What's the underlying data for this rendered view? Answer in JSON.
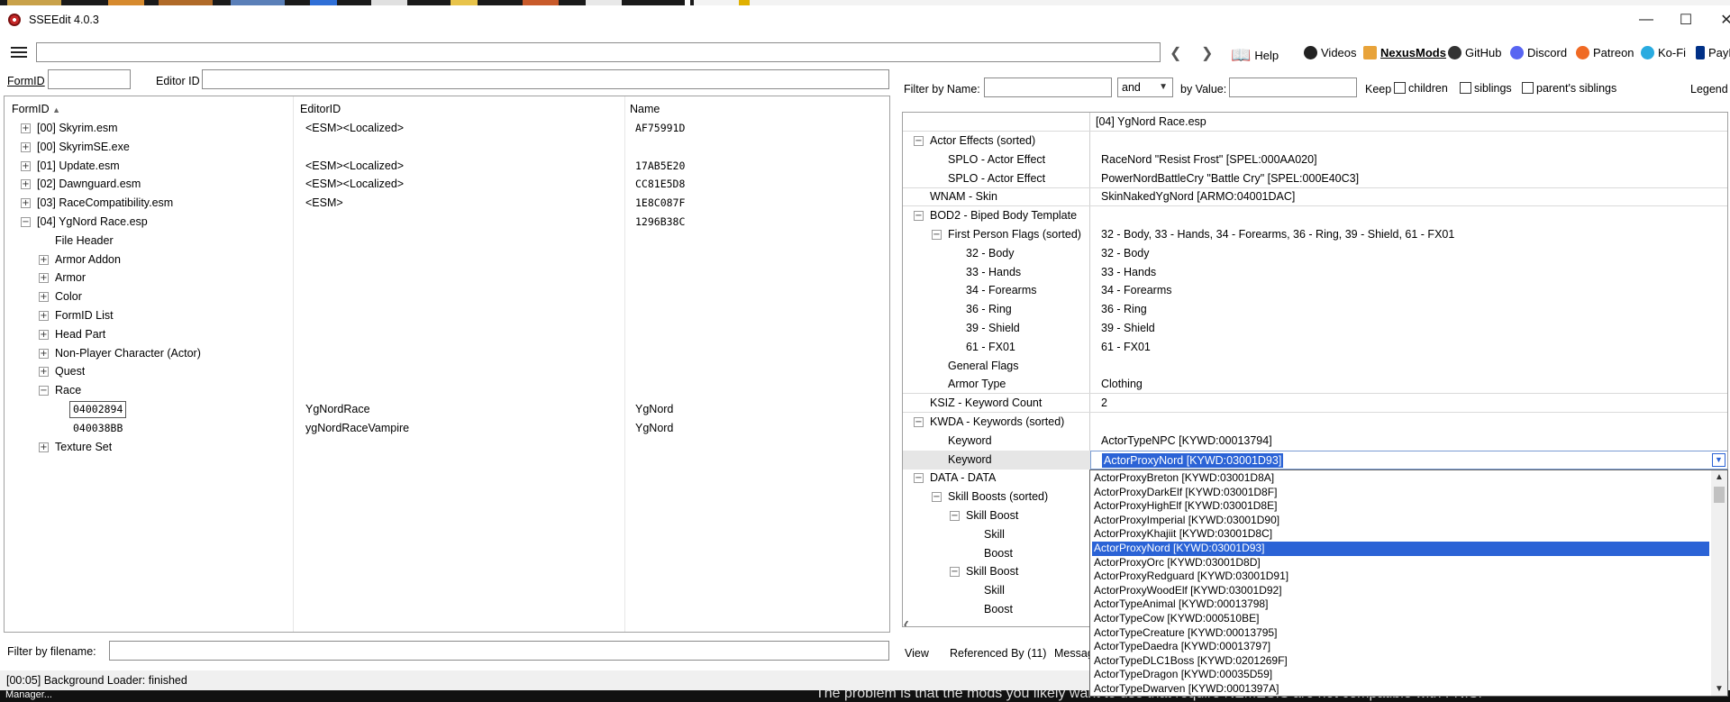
{
  "window": {
    "title": "SSEEdit 4.0.3"
  },
  "toolbar": {
    "links": [
      {
        "label": "Help",
        "icon": "book-icon"
      },
      {
        "label": "Videos",
        "icon": "video-icon"
      },
      {
        "label": "NexusMods",
        "icon": "nexus-icon"
      },
      {
        "label": "GitHub",
        "icon": "github-icon"
      },
      {
        "label": "Discord",
        "icon": "discord-icon"
      },
      {
        "label": "Patreon",
        "icon": "patreon-icon"
      },
      {
        "label": "Ko-Fi",
        "icon": "kofi-icon"
      },
      {
        "label": "PayP",
        "icon": "paypal-icon"
      }
    ]
  },
  "left_filter": {
    "formid_label": "FormID",
    "editorid_label": "Editor ID"
  },
  "left_tree": {
    "headers": [
      "FormID",
      "EditorID",
      "Name"
    ],
    "rows": [
      {
        "indent": 0,
        "toggle": "+",
        "formid": "[00] Skyrim.esm",
        "editorid": "<ESM><Localized>",
        "name": "AF75991D"
      },
      {
        "indent": 0,
        "toggle": "+",
        "formid": "[00] SkyrimSE.exe",
        "editorid": "",
        "name": ""
      },
      {
        "indent": 0,
        "toggle": "+",
        "formid": "[01] Update.esm",
        "editorid": "<ESM><Localized>",
        "name": "17AB5E20"
      },
      {
        "indent": 0,
        "toggle": "+",
        "formid": "[02] Dawnguard.esm",
        "editorid": "<ESM><Localized>",
        "name": "CC81E5D8"
      },
      {
        "indent": 0,
        "toggle": "+",
        "formid": "[03] RaceCompatibility.esm",
        "editorid": "<ESM>",
        "name": "1E8C087F"
      },
      {
        "indent": 0,
        "toggle": "-",
        "formid": "[04] YgNord Race.esp",
        "editorid": "",
        "name": "1296B38C"
      },
      {
        "indent": 1,
        "toggle": "",
        "formid": "File Header",
        "editorid": "",
        "name": ""
      },
      {
        "indent": 1,
        "toggle": "+",
        "formid": "Armor Addon",
        "editorid": "",
        "name": ""
      },
      {
        "indent": 1,
        "toggle": "+",
        "formid": "Armor",
        "editorid": "",
        "name": ""
      },
      {
        "indent": 1,
        "toggle": "+",
        "formid": "Color",
        "editorid": "",
        "name": ""
      },
      {
        "indent": 1,
        "toggle": "+",
        "formid": "FormID List",
        "editorid": "",
        "name": ""
      },
      {
        "indent": 1,
        "toggle": "+",
        "formid": "Head Part",
        "editorid": "",
        "name": ""
      },
      {
        "indent": 1,
        "toggle": "+",
        "formid": "Non-Player Character (Actor)",
        "editorid": "",
        "name": ""
      },
      {
        "indent": 1,
        "toggle": "+",
        "formid": "Quest",
        "editorid": "",
        "name": ""
      },
      {
        "indent": 1,
        "toggle": "-",
        "formid": "Race",
        "editorid": "",
        "name": ""
      },
      {
        "indent": 2,
        "toggle": "",
        "formid": "04002894",
        "editorid": "YgNordRace",
        "name": "YgNord",
        "focused": true
      },
      {
        "indent": 2,
        "toggle": "",
        "formid": "040038BB",
        "editorid": "ygNordRaceVampire",
        "name": "YgNord"
      },
      {
        "indent": 1,
        "toggle": "+",
        "formid": "Texture Set",
        "editorid": "",
        "name": ""
      }
    ]
  },
  "left_bottom": {
    "filter_label": "Filter by filename:"
  },
  "status": {
    "text": "[00:05] Background Loader: finished"
  },
  "taskbar": {
    "left_text": "Manager...",
    "right_text": "The problem is that the mods you likely want to use that require NEMESIS are not compatible with FNIS!"
  },
  "right_filter": {
    "name_label": "Filter by Name:",
    "operator": "and",
    "value_label": "by Value:",
    "keep_label": "Keep",
    "checkboxes": [
      "children",
      "siblings",
      "parent's siblings"
    ],
    "legend_label": "Legend"
  },
  "record": {
    "header": "[04] YgNord Race.esp",
    "rows": [
      {
        "indent": 0,
        "toggle": "-",
        "name": "Actor Effects (sorted)",
        "value": ""
      },
      {
        "indent": 1,
        "toggle": "",
        "name": "SPLO - Actor Effect",
        "value": "RaceNord \"Resist Frost\" [SPEL:000AA020]"
      },
      {
        "indent": 1,
        "toggle": "",
        "name": "SPLO - Actor Effect",
        "value": "PowerNordBattleCry \"Battle Cry\" [SPEL:000E40C3]",
        "line": true
      },
      {
        "indent": 0,
        "toggle": "",
        "name": "WNAM - Skin",
        "value": "SkinNakedYgNord [ARMO:04001DAC]",
        "line": true
      },
      {
        "indent": 0,
        "toggle": "-",
        "name": "BOD2 - Biped Body Template",
        "value": ""
      },
      {
        "indent": 1,
        "toggle": "-",
        "name": "First Person Flags (sorted)",
        "value": "32 - Body, 33 - Hands, 34 - Forearms, 36 - Ring, 39 - Shield, 61 - FX01"
      },
      {
        "indent": 2,
        "toggle": "",
        "name": "32 - Body",
        "value": "32 - Body"
      },
      {
        "indent": 2,
        "toggle": "",
        "name": "33 - Hands",
        "value": "33 - Hands"
      },
      {
        "indent": 2,
        "toggle": "",
        "name": "34 - Forearms",
        "value": "34 - Forearms"
      },
      {
        "indent": 2,
        "toggle": "",
        "name": "36 - Ring",
        "value": "36 - Ring"
      },
      {
        "indent": 2,
        "toggle": "",
        "name": "39 - Shield",
        "value": "39 - Shield"
      },
      {
        "indent": 2,
        "toggle": "",
        "name": "61 - FX01",
        "value": "61 - FX01"
      },
      {
        "indent": 1,
        "toggle": "",
        "name": "General Flags",
        "value": ""
      },
      {
        "indent": 1,
        "toggle": "",
        "name": "Armor Type",
        "value": "Clothing",
        "line": true
      },
      {
        "indent": 0,
        "toggle": "",
        "name": "KSIZ - Keyword Count",
        "value": "2",
        "line": true
      },
      {
        "indent": 0,
        "toggle": "-",
        "name": "KWDA - Keywords (sorted)",
        "value": ""
      },
      {
        "indent": 1,
        "toggle": "",
        "name": "Keyword",
        "value": "ActorTypeNPC [KYWD:00013794]"
      },
      {
        "indent": 1,
        "toggle": "",
        "name": "Keyword",
        "value": "",
        "editing": true
      },
      {
        "indent": 0,
        "toggle": "-",
        "name": "DATA - DATA",
        "value": ""
      },
      {
        "indent": 1,
        "toggle": "-",
        "name": "Skill Boosts (sorted)",
        "value": ""
      },
      {
        "indent": 2,
        "toggle": "-",
        "name": "Skill Boost",
        "value": ""
      },
      {
        "indent": 3,
        "toggle": "",
        "name": "Skill",
        "value": ""
      },
      {
        "indent": 3,
        "toggle": "",
        "name": "Boost",
        "value": ""
      },
      {
        "indent": 2,
        "toggle": "-",
        "name": "Skill Boost",
        "value": ""
      },
      {
        "indent": 3,
        "toggle": "",
        "name": "Skill",
        "value": ""
      },
      {
        "indent": 3,
        "toggle": "",
        "name": "Boost",
        "value": ""
      }
    ]
  },
  "keyword_combo": {
    "selected": "ActorProxyNord [KYWD:03001D93]",
    "options": [
      "ActorProxyBreton [KYWD:03001D8A]",
      "ActorProxyDarkElf [KYWD:03001D8F]",
      "ActorProxyHighElf [KYWD:03001D8E]",
      "ActorProxyImperial [KYWD:03001D90]",
      "ActorProxyKhajiit [KYWD:03001D8C]",
      "ActorProxyNord [KYWD:03001D93]",
      "ActorProxyOrc [KYWD:03001D8D]",
      "ActorProxyRedguard [KYWD:03001D91]",
      "ActorProxyWoodElf [KYWD:03001D92]",
      "ActorTypeAnimal [KYWD:00013798]",
      "ActorTypeCow [KYWD:000510BE]",
      "ActorTypeCreature [KYWD:00013795]",
      "ActorTypeDaedra [KYWD:00013797]",
      "ActorTypeDLC1Boss [KYWD:0201269F]",
      "ActorTypeDragon [KYWD:00035D59]",
      "ActorTypeDwarven [KYWD:0001397A]"
    ],
    "selected_index": 5
  },
  "bottom_tabs": [
    "View",
    "Referenced By (11)",
    "Messag"
  ],
  "colors": {
    "selection": "#2b63d6"
  }
}
